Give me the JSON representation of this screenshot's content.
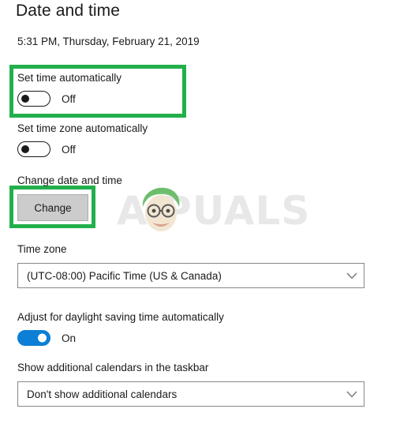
{
  "page": {
    "title": "Date and time",
    "current_datetime": "5:31 PM, Thursday, February 21, 2019"
  },
  "watermark": {
    "text": "A PUALS",
    "icon": "appuals-mascot-face",
    "color": "#e8e8e8",
    "hair_color": "#7ec67e",
    "skin_color": "#f5e3c8"
  },
  "highlights": {
    "color": "#21b04b",
    "boxes": [
      {
        "name": "set-time-automatically-highlight"
      },
      {
        "name": "change-button-highlight"
      }
    ]
  },
  "settings": {
    "set_time_automatically": {
      "label": "Set time automatically",
      "state": "Off",
      "on": false
    },
    "set_time_zone_automatically": {
      "label": "Set time zone automatically",
      "state": "Off",
      "on": false
    },
    "change_date_and_time": {
      "label": "Change date and time",
      "button_label": "Change"
    },
    "time_zone": {
      "label": "Time zone",
      "value": "(UTC-08:00) Pacific Time (US & Canada)",
      "chevron": "chevron-down-icon"
    },
    "daylight_saving": {
      "label": "Adjust for daylight saving time automatically",
      "state": "On",
      "on": true,
      "accent_color": "#0d7fd6"
    },
    "additional_calendars": {
      "label": "Show additional calendars in the taskbar",
      "value": "Don't show additional calendars",
      "chevron": "chevron-down-icon"
    }
  }
}
